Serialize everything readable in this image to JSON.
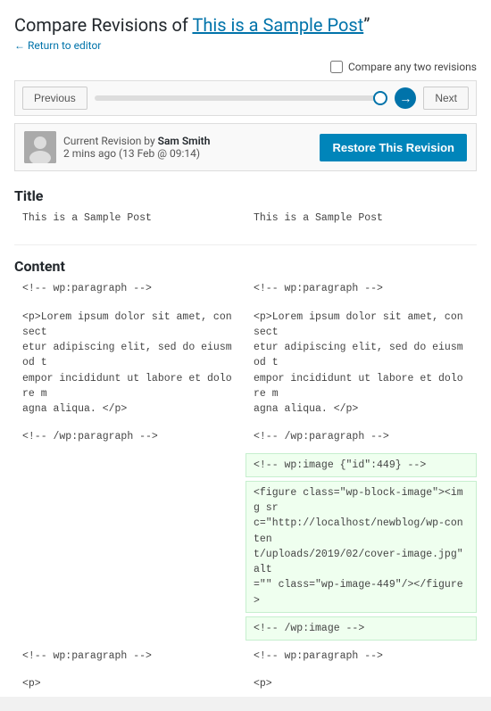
{
  "header": {
    "title_prefix": "Compare Revisions of ",
    "post_title": "This is a Sample Post",
    "return_link": "← Return to editor"
  },
  "compare_checkbox": {
    "label": "Compare any two revisions"
  },
  "nav": {
    "prev_label": "Previous",
    "next_label": "Next"
  },
  "revision": {
    "label": "Current Revision by ",
    "author": "Sam Smith",
    "time": "2 mins ago (13 Feb @ 09:14)",
    "restore_label": "Restore This Revision"
  },
  "sections": [
    {
      "id": "title",
      "heading": "Title",
      "left": "This is a Sample Post",
      "right": "This is a Sample Post",
      "right_added": false
    },
    {
      "id": "content",
      "heading": "Content",
      "blocks": [
        {
          "left": "<!-- wp:paragraph -->",
          "right": "<!-- wp:paragraph -->",
          "right_added": false
        },
        {
          "left": "<p>Lorem ipsum dolor sit amet, consect\netur adipiscing elit, sed do eiusmod t\nempor incididunt ut labore et dolore m\nagna aliqua. </p>",
          "right": "<p>Lorem ipsum dolor sit amet, consect\netur adipiscing elit, sed do eiusmod t\nempor incididunt ut labore et dolore m\nagna aliqua. </p>",
          "right_added": false
        },
        {
          "left": "<!-- /wp:paragraph -->",
          "right": "<!-- /wp:paragraph -->",
          "right_added": false
        },
        {
          "left": "",
          "right": "<!-- wp:image {\"id\":449} -->",
          "right_added": true
        },
        {
          "left": "",
          "right": "<figure class=\"wp-block-image\"><img sr\nc=\"http://localhost/newblog/wp-conten\nt/uploads/2019/02/cover-image.jpg\" alt\n=\"\" class=\"wp-image-449\"/></figure>",
          "right_added": true
        },
        {
          "left": "",
          "right": "<!-- /wp:image -->",
          "right_added": true
        },
        {
          "left": "<!-- wp:paragraph -->",
          "right": "<!-- wp:paragraph -->",
          "right_added": false
        },
        {
          "left": "<p>",
          "right": "<p>",
          "right_added": false
        }
      ]
    }
  ]
}
